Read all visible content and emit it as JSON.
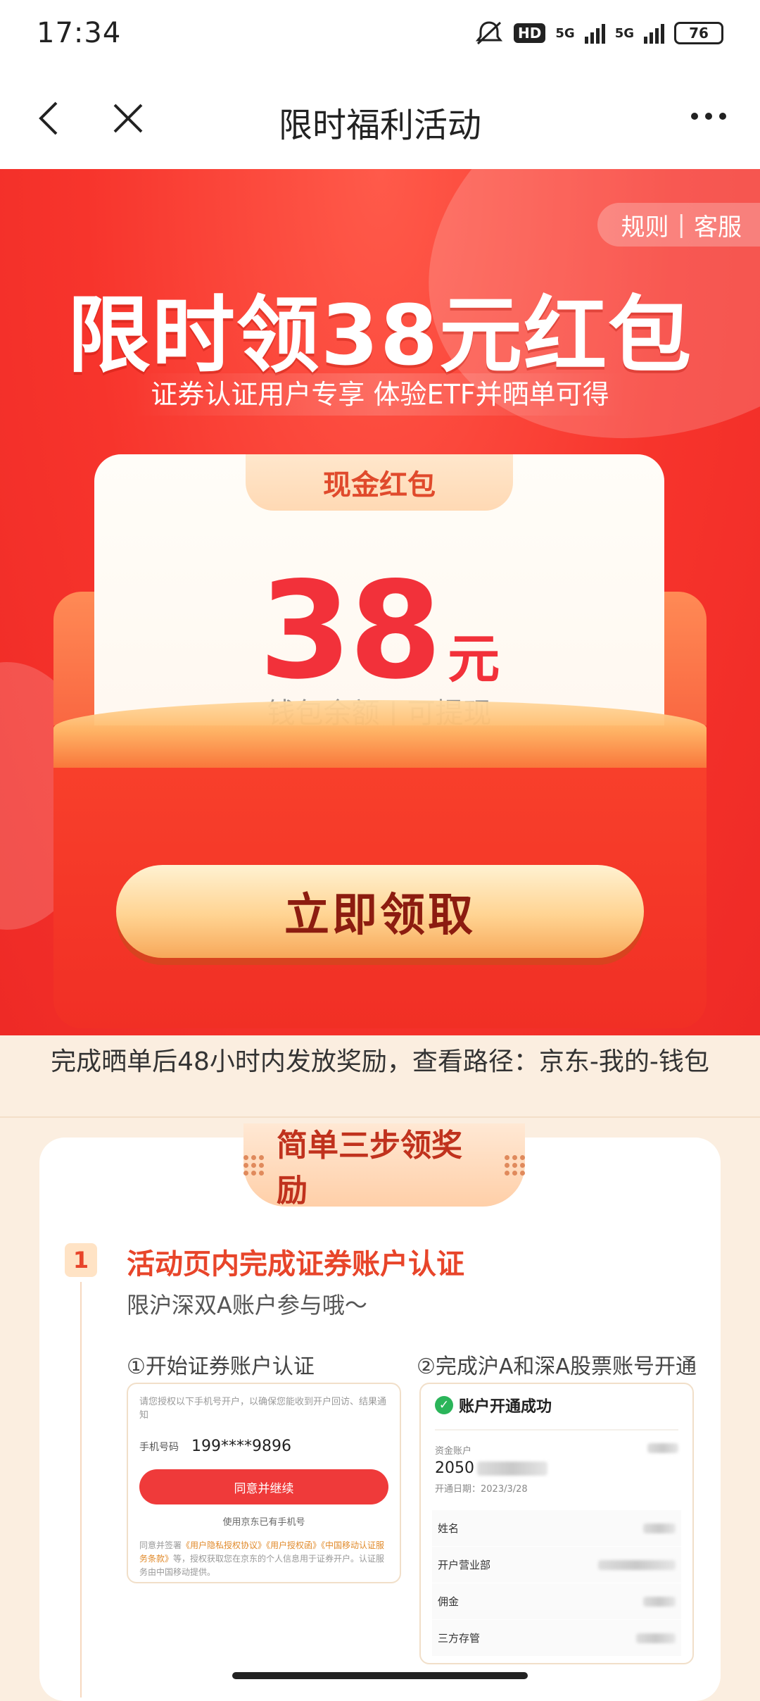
{
  "status_bar": {
    "time": "17:34",
    "network1": "5G",
    "network2": "5G",
    "hd": "HD",
    "battery": "76"
  },
  "nav": {
    "title": "限时福利活动"
  },
  "hero": {
    "rules": "规则",
    "service": "客服",
    "headline": "限时领38元红包",
    "subline": "证券认证用户专享 体验ETF并晒单可得",
    "card_tag": "现金红包",
    "amount": "38",
    "unit": "元",
    "amount_desc": "钱包余额 | 可提现",
    "claim_button": "立即领取"
  },
  "notice": "完成晒单后48小时内发放奖励，查看路径：京东-我的-钱包",
  "steps": {
    "title": "简单三步领奖励",
    "step1": {
      "number": "1",
      "title": "活动页内完成证券账户认证",
      "subtitle": "限沪深双A账户参与哦～",
      "col1_label": "①开始证券账户认证",
      "col2_label": "②完成沪A和深A股票账号开通",
      "mini1": {
        "hint": "请您授权以下手机号开户，以确保您能收到开户回访、结果通知",
        "phone_label": "手机号码",
        "phone": "199****9896",
        "agree_button": "同意并继续",
        "use_other": "使用京东已有手机号",
        "legal_prefix": "同意并签署",
        "legal_links": "《用户隐私授权协议》《用户授权函》《中国移动认证服务条款》",
        "legal_suffix": "等，授权获取您在京东的个人信息用于证券开户。认证服务由中国移动提供。"
      },
      "mini2": {
        "success": "账户开通成功",
        "account_label": "资金账户",
        "account_prefix": "2050",
        "open_date": "开通日期：2023/3/28",
        "rows": [
          "姓名",
          "开户营业部",
          "佣金",
          "三方存管"
        ]
      }
    }
  }
}
